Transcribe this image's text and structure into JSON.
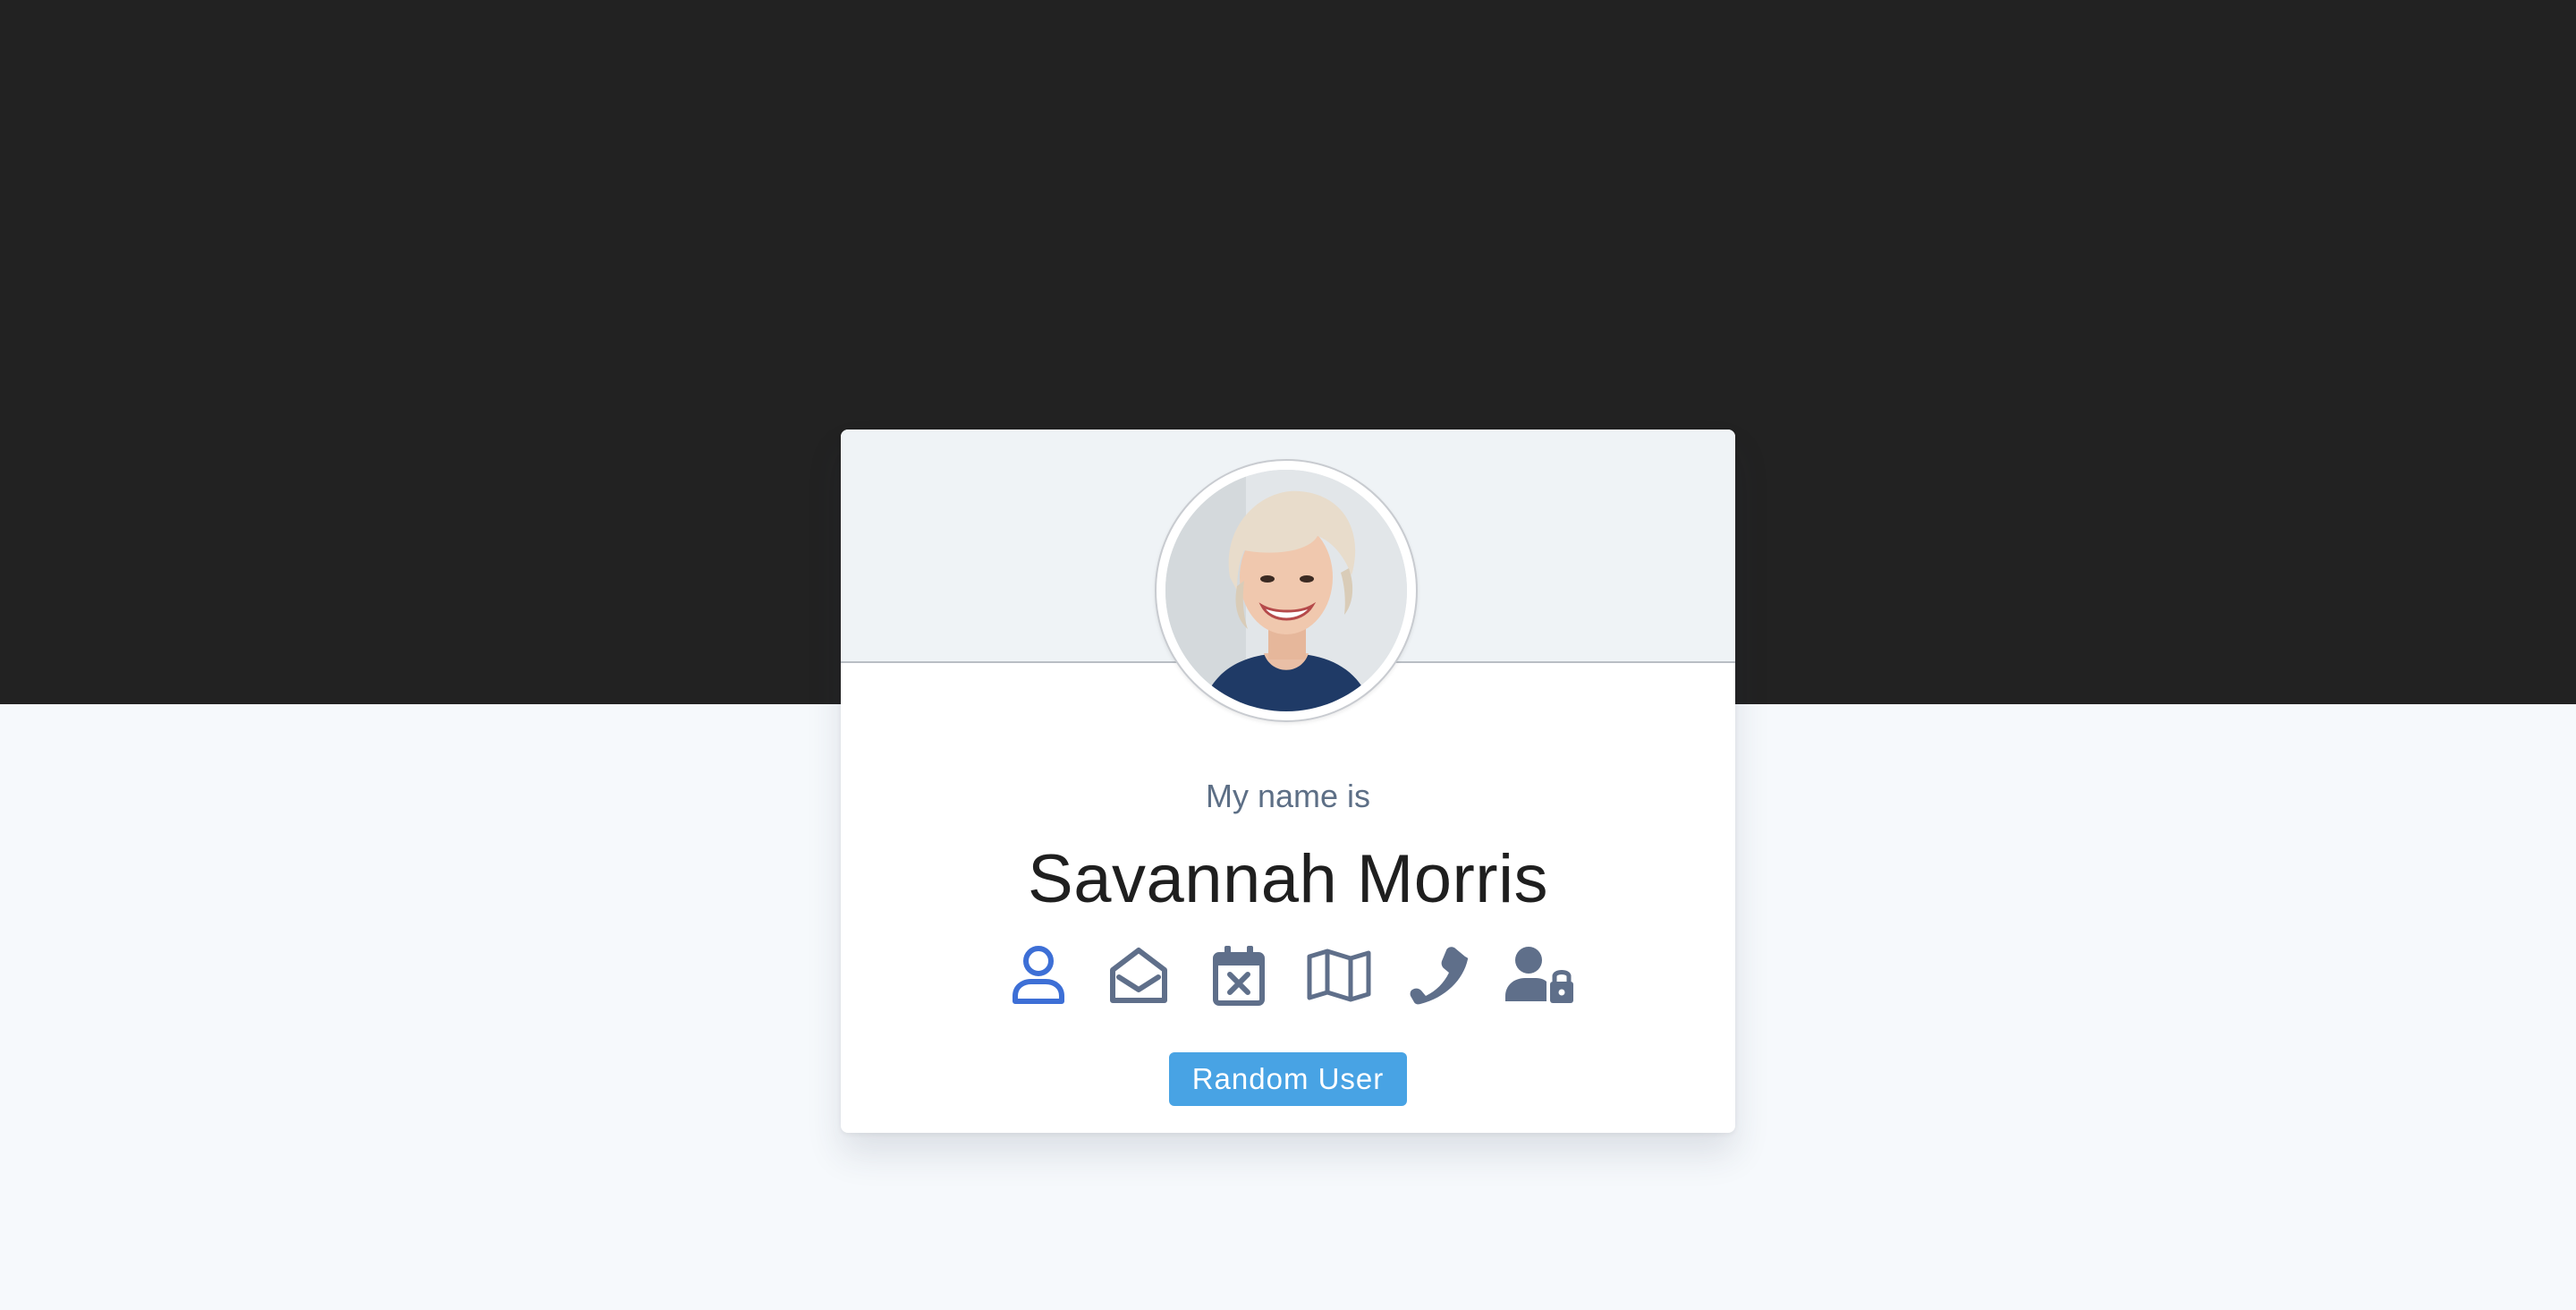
{
  "card": {
    "title": "My name is",
    "value": "Savannah Morris",
    "avatar_alt": "user photo"
  },
  "icons": [
    {
      "name": "user-icon",
      "active": true
    },
    {
      "name": "envelope-open-icon",
      "active": false
    },
    {
      "name": "calendar-x-icon",
      "active": false
    },
    {
      "name": "map-icon",
      "active": false
    },
    {
      "name": "phone-icon",
      "active": false
    },
    {
      "name": "user-lock-icon",
      "active": false
    }
  ],
  "button": {
    "label": "Random User"
  },
  "colors": {
    "background_dark": "#222222",
    "background_light": "#f6f9fc",
    "header_bg": "#eff3f6",
    "icon_active": "#3d6fd6",
    "icon_default": "#5f6f8a",
    "button_bg": "#48a3e4",
    "title_text": "#5d6f86",
    "value_text": "#1f1f1f"
  }
}
